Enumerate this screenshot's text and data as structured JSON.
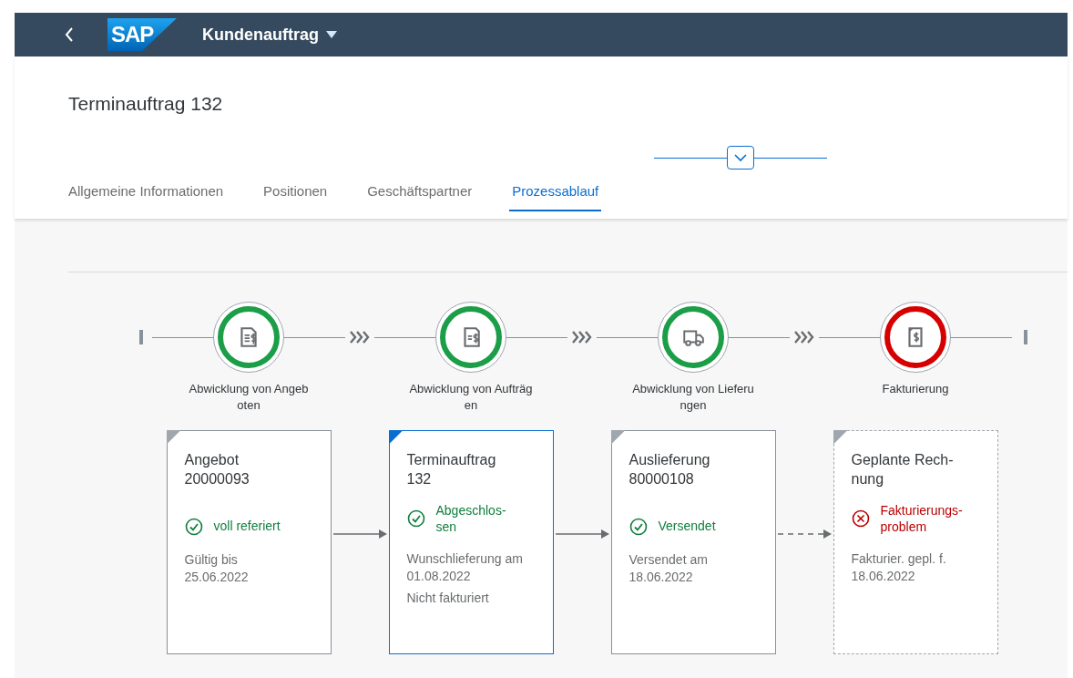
{
  "shell": {
    "logo": "SAP",
    "title": "Kundenauftrag"
  },
  "page": {
    "title": "Terminauftrag 132"
  },
  "tabs": [
    {
      "label": "Allgemeine Informationen",
      "selected": false
    },
    {
      "label": "Positionen",
      "selected": false
    },
    {
      "label": "Geschäftspartner",
      "selected": false
    },
    {
      "label": "Prozessablauf",
      "selected": true
    }
  ],
  "process": {
    "lanes": [
      {
        "label_lines": [
          "Abwicklung von Angeb",
          "oten"
        ],
        "error": false,
        "kind": "quote"
      },
      {
        "label_lines": [
          "Abwicklung von Aufträg",
          "en"
        ],
        "error": false,
        "kind": "order"
      },
      {
        "label_lines": [
          "Abwicklung von Lieferu",
          "ngen"
        ],
        "error": false,
        "kind": "delivery"
      },
      {
        "label_lines": [
          "Fakturierung"
        ],
        "error": true,
        "kind": "invoice"
      }
    ],
    "cards": [
      {
        "title_lines": [
          "Angebot",
          "20000093"
        ],
        "error": false,
        "status_lines": [
          "voll referiert"
        ],
        "details": [
          [
            "Gültig bis",
            "25.06.2022"
          ]
        ],
        "selected": false,
        "planned": false,
        "dashed_link": false
      },
      {
        "title_lines": [
          "Terminauftrag",
          "132"
        ],
        "error": false,
        "status_lines": [
          "Abgeschlos-",
          "sen"
        ],
        "details": [
          [
            "Wunschlieferung am",
            "01.08.2022"
          ],
          [
            "Nicht fakturiert"
          ]
        ],
        "selected": true,
        "planned": false,
        "dashed_link": false
      },
      {
        "title_lines": [
          "Auslieferung",
          "80000108"
        ],
        "error": false,
        "status_lines": [
          "Versendet"
        ],
        "details": [
          [
            "Versendet am",
            "18.06.2022"
          ]
        ],
        "selected": false,
        "planned": false,
        "dashed_link": true
      },
      {
        "title_lines": [
          "Geplante Rech-",
          "nung"
        ],
        "error": true,
        "status_lines": [
          "Fakturierungs-",
          "problem"
        ],
        "details": [
          [
            "Fakturier. gepl. f.",
            "18.06.2022"
          ]
        ],
        "selected": false,
        "planned": true
      }
    ]
  }
}
